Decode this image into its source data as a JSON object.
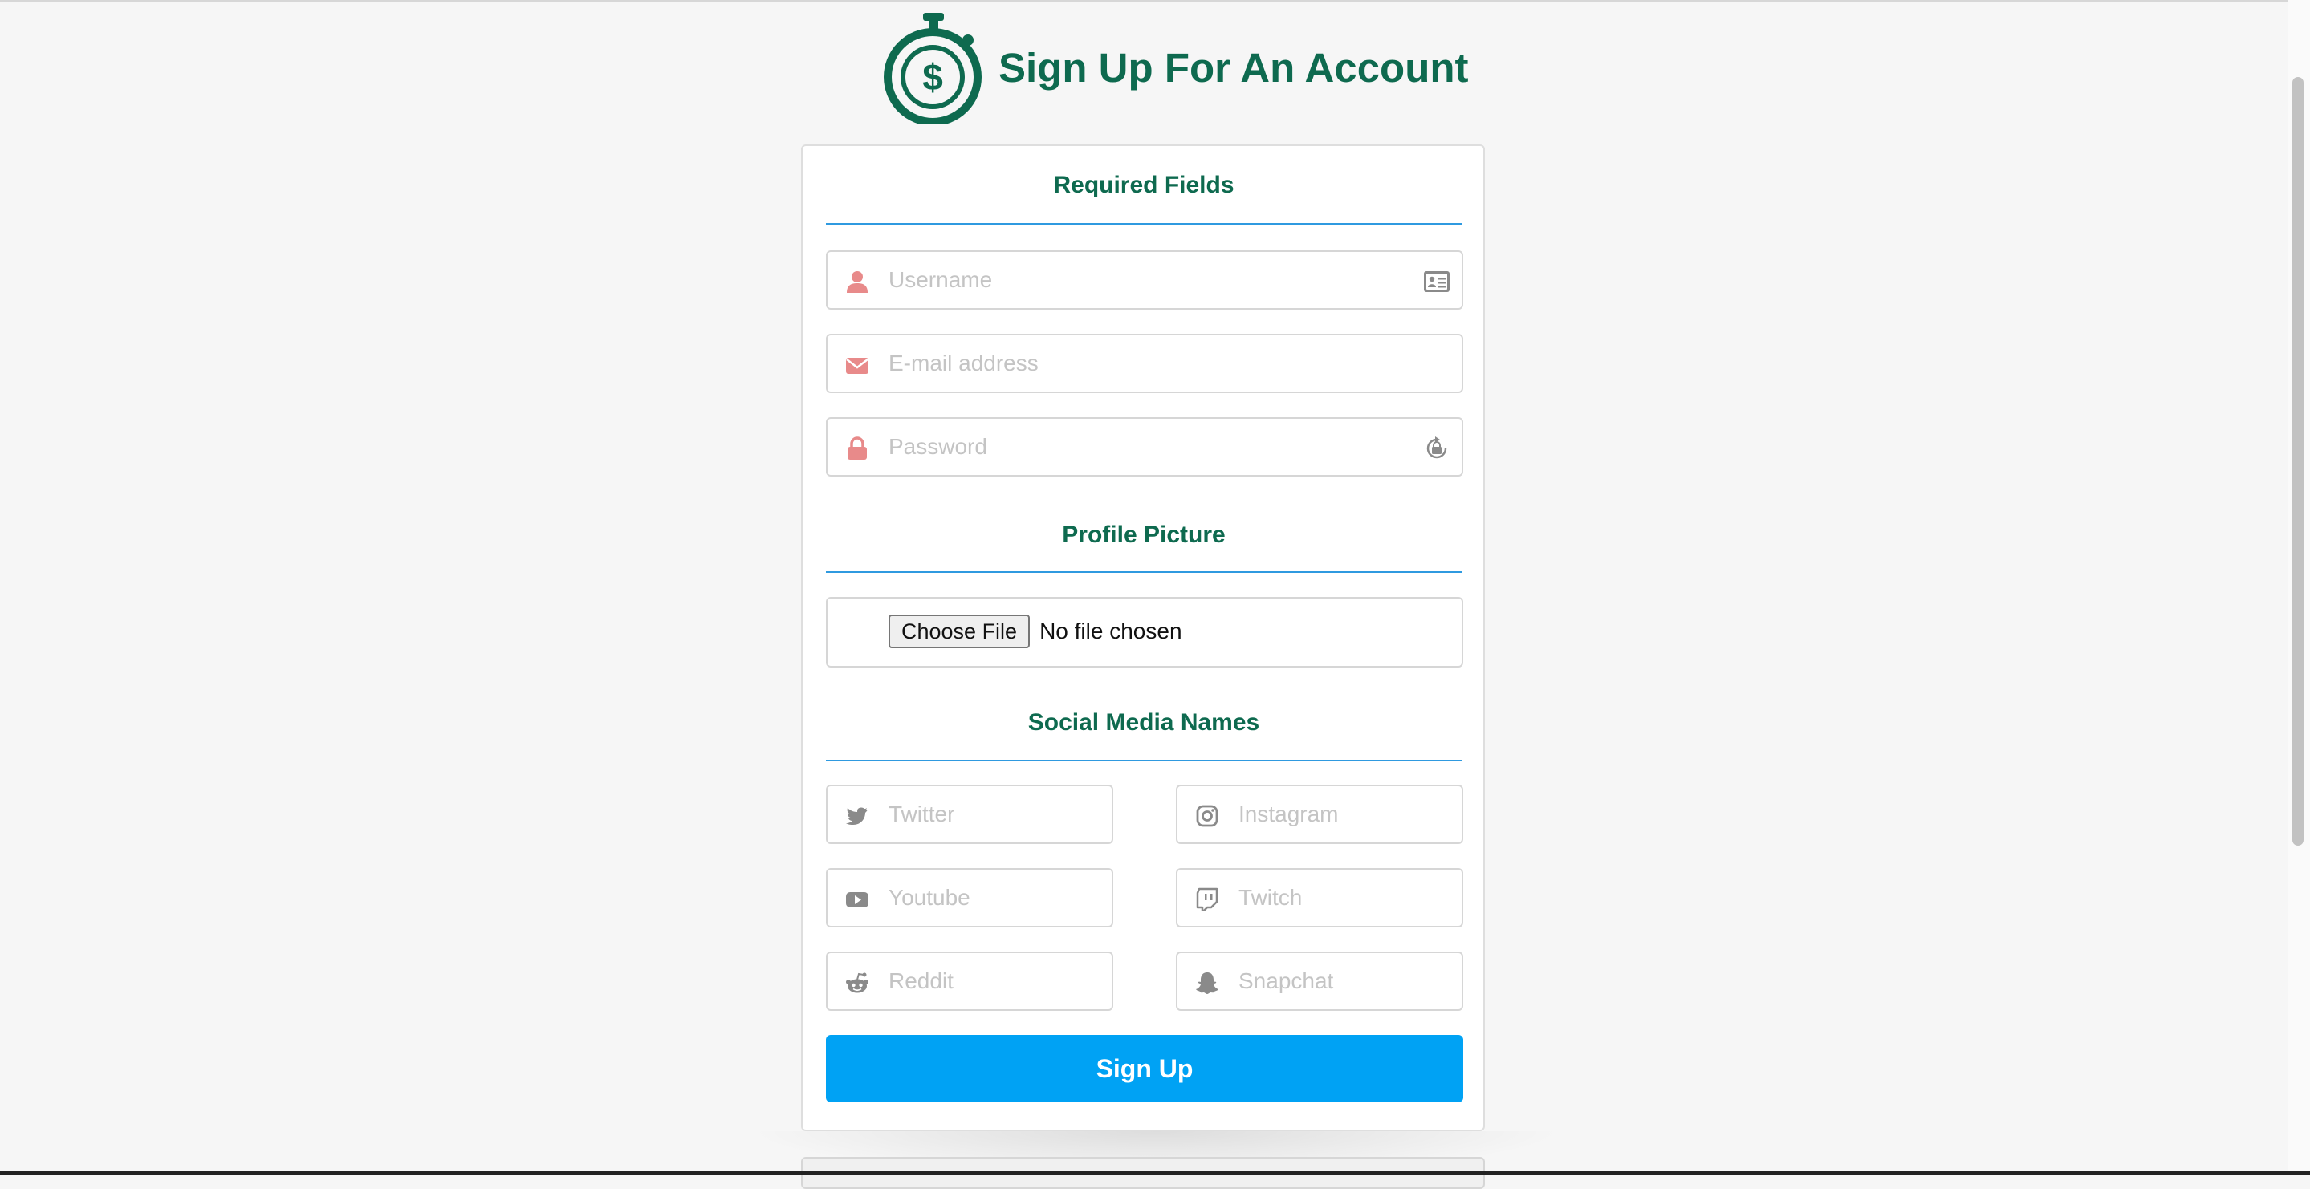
{
  "header": {
    "title": "Sign Up For An Account",
    "logo_icon": "stopwatch-dollar-icon"
  },
  "sections": {
    "required": "Required Fields",
    "picture": "Profile Picture",
    "social": "Social Media Names"
  },
  "fields": {
    "username": {
      "placeholder": "Username",
      "icon": "user-icon",
      "trailing_icon": "id-card-icon"
    },
    "email": {
      "placeholder": "E-mail address",
      "icon": "envelope-icon"
    },
    "password": {
      "placeholder": "Password",
      "icon": "lock-icon",
      "trailing_icon": "password-lock-icon"
    }
  },
  "file_upload": {
    "button": "Choose File",
    "status": "No file chosen"
  },
  "social": {
    "twitter": {
      "placeholder": "Twitter",
      "icon": "twitter-icon"
    },
    "instagram": {
      "placeholder": "Instagram",
      "icon": "instagram-icon"
    },
    "youtube": {
      "placeholder": "Youtube",
      "icon": "youtube-icon"
    },
    "twitch": {
      "placeholder": "Twitch",
      "icon": "twitch-icon"
    },
    "reddit": {
      "placeholder": "Reddit",
      "icon": "reddit-icon"
    },
    "snapchat": {
      "placeholder": "Snapchat",
      "icon": "snapchat-icon"
    }
  },
  "submit": "Sign Up",
  "colors": {
    "brand_green": "#0e6a4f",
    "accent_blue": "#00a2f4",
    "rule_blue": "#2f9ae0",
    "required_icon": "#e88a8a",
    "social_icon": "#8a8a8a"
  }
}
